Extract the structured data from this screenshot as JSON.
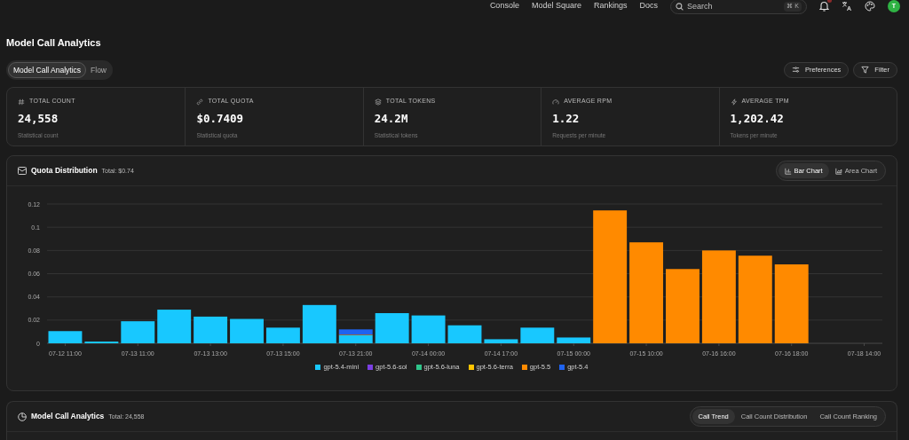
{
  "nav": {
    "links": [
      "Console",
      "Model Square",
      "Rankings",
      "Docs"
    ],
    "search": {
      "placeholder": "Search",
      "shortcut": "⌘ K"
    },
    "avatar": "T"
  },
  "page": {
    "title": "Model Call Analytics",
    "tabs": [
      {
        "label": "Model Call Analytics",
        "selected": true
      },
      {
        "label": "Flow",
        "selected": false
      }
    ],
    "buttons": [
      {
        "kind": "preferences",
        "label": "Preferences"
      },
      {
        "kind": "filter",
        "label": "Filter"
      }
    ]
  },
  "stats": [
    {
      "kind": "count",
      "label": "TOTAL COUNT",
      "value": "24,558",
      "caption": "Statistical count"
    },
    {
      "kind": "quota",
      "label": "TOTAL QUOTA",
      "value": "$0.7409",
      "caption": "Statistical quota"
    },
    {
      "kind": "tokens",
      "label": "TOTAL TOKENS",
      "value": "24.2M",
      "caption": "Statistical tokens"
    },
    {
      "kind": "rpm",
      "label": "AVERAGE RPM",
      "value": "1.22",
      "caption": "Requests per minute"
    },
    {
      "kind": "tpm",
      "label": "AVERAGE TPM",
      "value": "1,202.42",
      "caption": "Tokens per minute"
    }
  ],
  "quota_panel": {
    "title": "Quota Distribution",
    "total": "Total: $0.74",
    "toggles": [
      {
        "kind": "bar",
        "label": "Bar Chart",
        "selected": true
      },
      {
        "kind": "area",
        "label": "Area Chart",
        "selected": false
      }
    ],
    "chart_data": {
      "type": "bar",
      "stacked": true,
      "categories": [
        "07-12 11:00",
        null,
        "07-13 11:00",
        null,
        "07-13 13:00",
        null,
        "07-13 15:00",
        null,
        "07-13 21:00",
        null,
        "07-14 00:00",
        null,
        "07-14 17:00",
        null,
        "07-15 00:00",
        null,
        "07-15 10:00",
        null,
        "07-16 16:00",
        null,
        "07-16 18:00",
        null,
        "07-18 14:00"
      ],
      "yticks": [
        {
          "value": 0,
          "label": "0"
        },
        {
          "value": 0.02,
          "label": "0.02"
        },
        {
          "value": 0.04,
          "label": "0.04"
        },
        {
          "value": 0.06,
          "label": "0.06"
        },
        {
          "value": 0.08,
          "label": "0.08"
        },
        {
          "value": 0.1,
          "label": "0.1"
        },
        {
          "value": 0.12,
          "label": "0.12"
        }
      ],
      "ylim": [
        0,
        0.12
      ],
      "grid": true,
      "series": [
        {
          "name": "gpt-5.4-mini",
          "color": "#18c8ff",
          "values": [
            0.0105,
            0.0015,
            0.019,
            0.029,
            0.023,
            0.021,
            0.0135,
            0.033,
            0.007,
            0.026,
            0.024,
            0.0155,
            0.0035,
            0.0135,
            0.005,
            0,
            0,
            0,
            0,
            0,
            0,
            0,
            0
          ]
        },
        {
          "name": "gpt-5.6-sol",
          "color": "#7b3fe4",
          "values": [
            0,
            0,
            0,
            0,
            0,
            0,
            0,
            0,
            0,
            0,
            0,
            0,
            0,
            0,
            0,
            0,
            0,
            0,
            0,
            0,
            0,
            0,
            0
          ]
        },
        {
          "name": "gpt-5.6-luna",
          "color": "#2fc58a",
          "values": [
            0,
            0,
            0,
            0,
            0,
            0,
            0,
            0,
            0,
            0,
            0,
            0,
            0,
            0,
            0,
            0,
            0,
            0,
            0,
            0,
            0,
            0,
            0
          ]
        },
        {
          "name": "gpt-5.6-terra",
          "color": "#ffc400",
          "values": [
            0,
            0,
            0,
            0,
            0,
            0,
            0,
            0,
            0,
            0,
            0,
            0,
            0,
            0,
            0,
            0,
            0,
            0,
            0,
            0,
            0,
            0,
            0
          ]
        },
        {
          "name": "gpt-5.5",
          "color": "#ff8a00",
          "values": [
            null,
            0,
            0,
            0,
            0,
            0,
            0,
            0,
            0.0005,
            0,
            0,
            0,
            0,
            0,
            0,
            0.1145,
            0.087,
            0.064,
            0.08,
            0.0755,
            0.068,
            null,
            0
          ]
        },
        {
          "name": "gpt-5.4",
          "color": "#1f63f0",
          "values": [
            0,
            0,
            0,
            0,
            0,
            0,
            0,
            0,
            0.0045,
            0,
            0,
            0,
            0,
            0,
            0,
            0,
            0,
            0,
            0,
            0,
            0,
            0,
            0
          ]
        }
      ]
    }
  },
  "calls_panel": {
    "title": "Model Call Analytics",
    "total": "Total: 24,558",
    "toggles": [
      {
        "label": "Call Trend",
        "selected": true
      },
      {
        "label": "Call Count Distribution",
        "selected": false
      },
      {
        "label": "Call Count Ranking",
        "selected": false
      }
    ]
  }
}
